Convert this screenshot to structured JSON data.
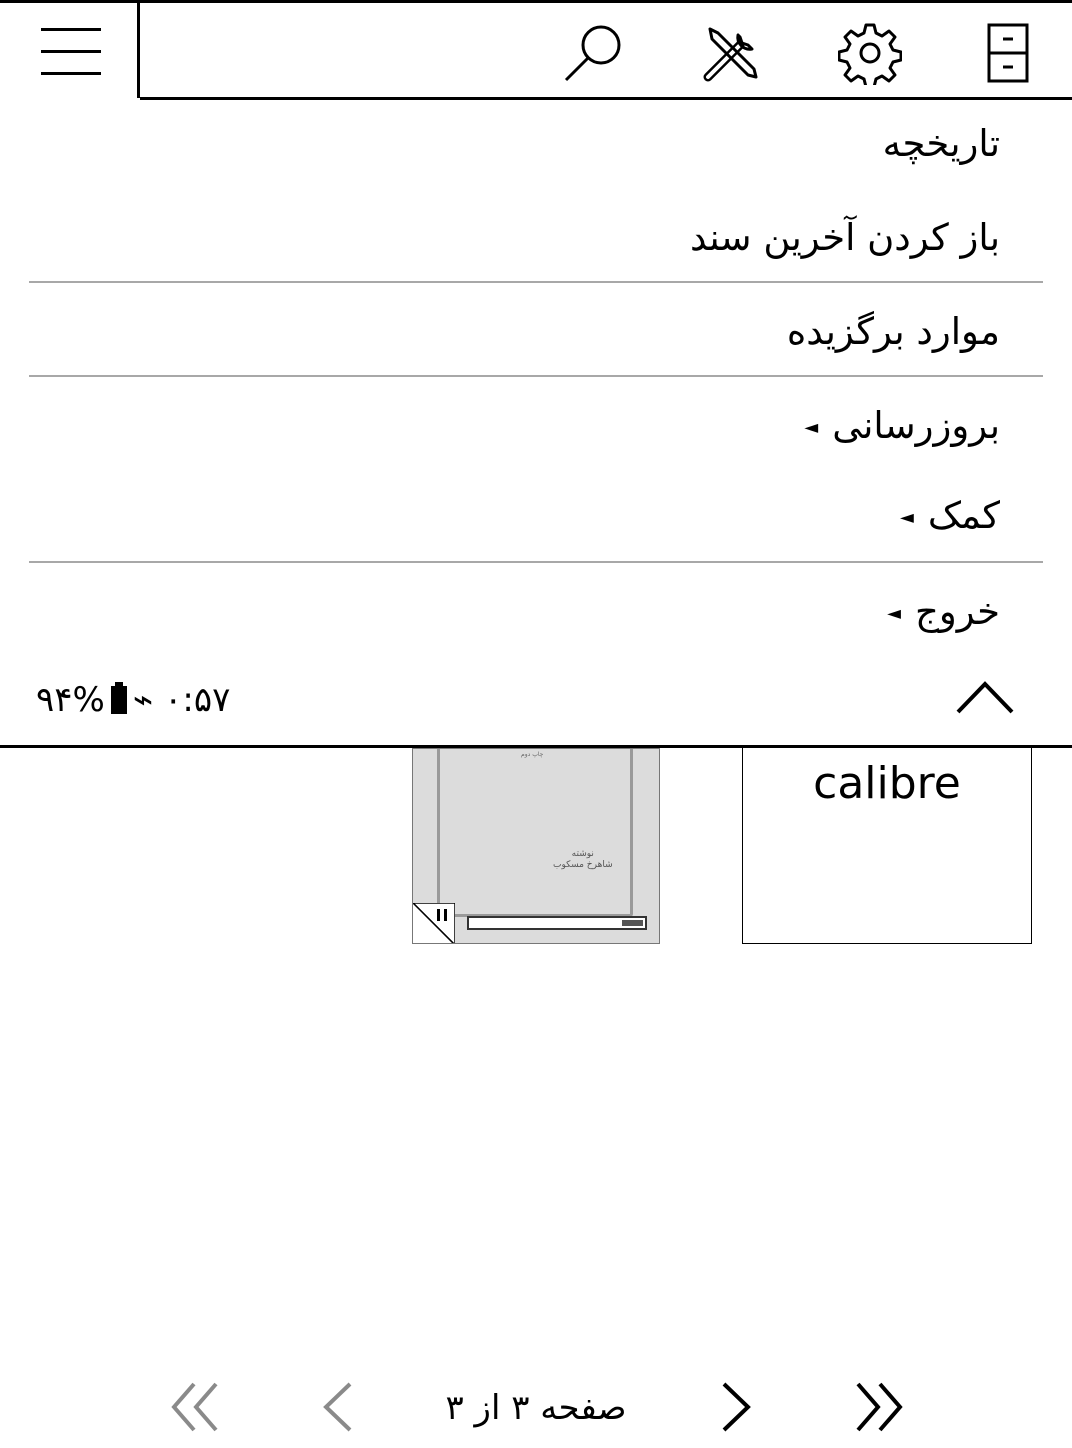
{
  "toolbar": {
    "menu_icon": "hamburger-menu-icon",
    "tabs": [
      {
        "name": "filemanager",
        "icon": "file-cabinet-icon"
      },
      {
        "name": "settings",
        "icon": "gear-icon"
      },
      {
        "name": "tools",
        "icon": "tools-icon"
      },
      {
        "name": "search",
        "icon": "search-icon"
      }
    ]
  },
  "menu": {
    "items": [
      {
        "label": "تاریخچه",
        "has_submenu": false
      },
      {
        "label": "باز کردن آخرین سند",
        "has_submenu": false
      },
      {
        "label": "موارد برگزیده",
        "has_submenu": false
      },
      {
        "label": "بروزرسانی",
        "has_submenu": true
      },
      {
        "label": "کمک",
        "has_submenu": true
      },
      {
        "label": "خروج",
        "has_submenu": true
      }
    ],
    "submenu_arrow": "◄",
    "status": {
      "time": "۰:۵۷",
      "wifi_symbol": "⌁",
      "battery": "۹۴%"
    },
    "collapse_icon": "chevron-up-icon"
  },
  "books": [
    {
      "title_lines": [
        "نوشته",
        "شاهرخ مسکوب"
      ],
      "header_text": "چاپ دوم",
      "progress_fraction": 0.12,
      "status_icon": "pause-icon"
    },
    {
      "title": "calibre"
    }
  ],
  "pager": {
    "label": "صفحه ۳ از ۳",
    "first_icon": "double-chevron-left-icon",
    "prev_icon": "chevron-left-icon",
    "next_icon": "chevron-right-icon",
    "last_icon": "double-chevron-right-icon"
  },
  "colors": {
    "foreground": "#000000",
    "background": "#ffffff",
    "separator": "#a8a8a8",
    "disabled": "#8a8a8a"
  }
}
